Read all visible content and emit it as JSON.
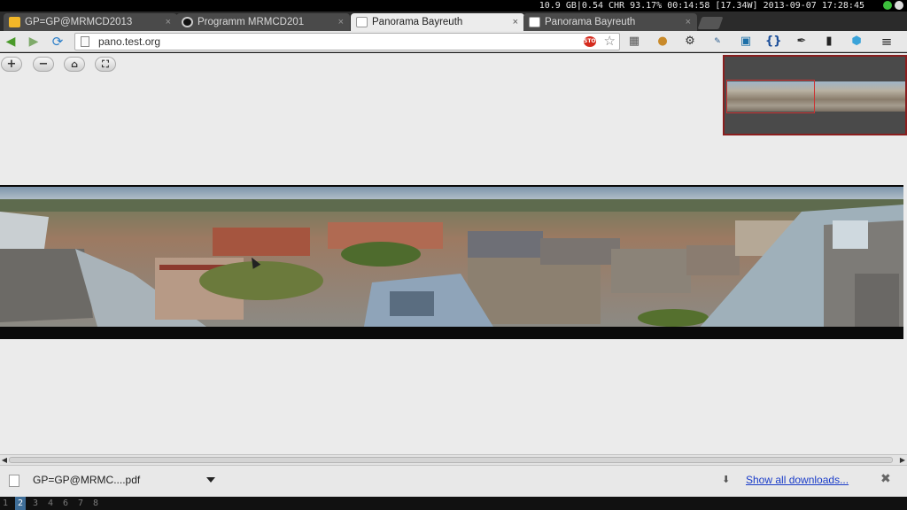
{
  "system_bar": {
    "status": "10.9 GB|0.54 CHR 93.17% 00:14:58 [17.34W] 2013-09-07 17:28:45",
    "tray_icons": [
      "network-icon",
      "battery-icon"
    ]
  },
  "tabs": [
    {
      "title": "GP=GP@MRMCD2013",
      "icon": "mail-icon",
      "active": false
    },
    {
      "title": "Programm MRMCD201",
      "icon": "github-icon",
      "active": false
    },
    {
      "title": "Panorama Bayreuth",
      "icon": "page-icon",
      "active": true
    },
    {
      "title": "Panorama Bayreuth",
      "icon": "page-icon",
      "active": false
    }
  ],
  "tab_close_glyph": "×",
  "toolbar": {
    "url": "pano.test.org",
    "stop_badge": "STOP",
    "extensions": [
      "reader-icon",
      "cookie-icon",
      "gear-icon",
      "css-icon",
      "screen-icon",
      "json-icon",
      "eyedropper-icon",
      "phone-icon",
      "cube-icon",
      "menu-icon"
    ]
  },
  "viewer": {
    "controls": [
      {
        "name": "zoom-in-button",
        "glyph": "+"
      },
      {
        "name": "zoom-out-button",
        "glyph": "−"
      },
      {
        "name": "home-button",
        "glyph": "⌂"
      },
      {
        "name": "fullscreen-button",
        "glyph": "⛶"
      }
    ]
  },
  "downloads": {
    "file_name": "GP=GP@MRMC....pdf",
    "show_all": "Show all downloads...",
    "close_glyph": "✖"
  },
  "workspaces": [
    "1",
    "2",
    "3",
    "4",
    "6",
    "7",
    "8"
  ],
  "current_workspace": "2"
}
